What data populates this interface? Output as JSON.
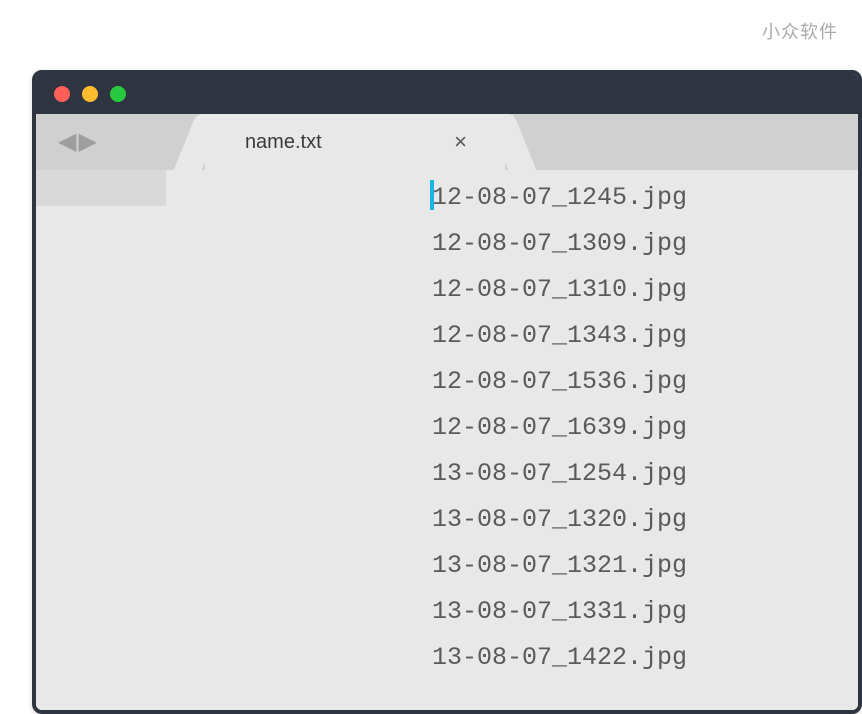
{
  "watermark": "小众软件",
  "tab": {
    "label": "name.txt",
    "close_label": "×"
  },
  "nav": {
    "back": "◀",
    "forward": "▶"
  },
  "lines": [
    "12-08-07_1245.jpg",
    "12-08-07_1309.jpg",
    "12-08-07_1310.jpg",
    "12-08-07_1343.jpg",
    "12-08-07_1536.jpg",
    "12-08-07_1639.jpg",
    "13-08-07_1254.jpg",
    "13-08-07_1320.jpg",
    "13-08-07_1321.jpg",
    "13-08-07_1331.jpg",
    "13-08-07_1422.jpg"
  ]
}
